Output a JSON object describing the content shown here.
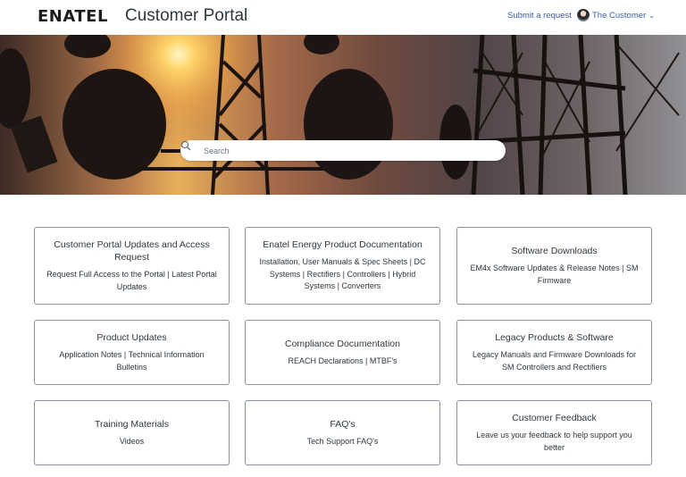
{
  "header": {
    "logo_text": "ENATEL",
    "portal_title": "Customer Portal",
    "submit_request": "Submit a request",
    "user_name": "The Customer"
  },
  "search": {
    "placeholder": "Search"
  },
  "categories": [
    {
      "title": "Customer Portal Updates and Access Request",
      "description": "Request Full Access to the Portal | Latest Portal Updates"
    },
    {
      "title": "Enatel Energy Product Documentation",
      "description": "Installation, User Manuals & Spec Sheets | DC Systems | Rectifiers | Controllers | Hybrid Systems | Converters"
    },
    {
      "title": "Software Downloads",
      "description": "EM4x Software Updates & Release Notes | SM Firmware"
    },
    {
      "title": "Product Updates",
      "description": "Application Notes | Technical Information Bulletins"
    },
    {
      "title": "Compliance Documentation",
      "description": "REACH Declarations | MTBF's"
    },
    {
      "title": "Legacy Products & Software",
      "description": "Legacy Manuals and Firmware Downloads for SM Controllers and Rectifiers"
    },
    {
      "title": "Training Materials",
      "description": "Videos"
    },
    {
      "title": "FAQ's",
      "description": "Tech Support FAQ's"
    },
    {
      "title": "Customer Feedback",
      "description": "Leave us your feedback to help support you better"
    }
  ],
  "colors": {
    "link": "#3a5bb8",
    "card_border": "#87929d",
    "text": "#2f3941"
  }
}
